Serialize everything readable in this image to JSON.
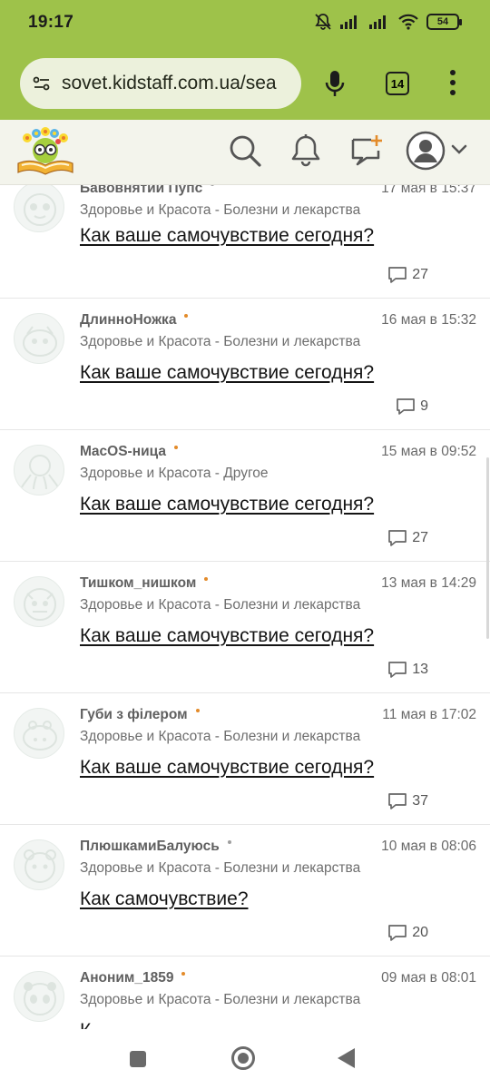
{
  "status_bar": {
    "time": "19:17",
    "battery": "54"
  },
  "browser": {
    "url": "sovet.kidstaff.com.ua/sea",
    "tabs_count": "14"
  },
  "site_header": {
    "icons": [
      "search-icon",
      "bell-icon",
      "new-post-icon",
      "avatar",
      "chevron-down-icon"
    ]
  },
  "feed": [
    {
      "author": "Бавовнятий Пупс",
      "date": "17 мая в 15:37",
      "category": "Здоровье и Красота - Болезни и лекарства",
      "title": "Как ваше самочувствие сегодня?",
      "comments": "27",
      "dot_color": "#9e9e9e"
    },
    {
      "author": "ДлинноНожка",
      "date": "16 мая в 15:32",
      "category": "Здоровье и Красота - Болезни и лекарства",
      "title": "Как ваше самочувствие сегодня?",
      "comments": "9",
      "dot_color": "#e38b2a"
    },
    {
      "author": "MacOS-ница",
      "date": "15 мая в 09:52",
      "category": "Здоровье и Красота - Другое",
      "title": "Как ваше самочувствие сегодня?",
      "comments": "27",
      "dot_color": "#e38b2a"
    },
    {
      "author": "Тишком_нишком",
      "date": "13 мая в 14:29",
      "category": "Здоровье и Красота - Болезни и лекарства",
      "title": "Как ваше самочувствие сегодня?",
      "comments": "13",
      "dot_color": "#e38b2a"
    },
    {
      "author": "Губи з філером",
      "date": "11 мая в 17:02",
      "category": "Здоровье и Красота - Болезни и лекарства",
      "title": "Как ваше самочувствие сегодня?",
      "comments": "37",
      "dot_color": "#e38b2a"
    },
    {
      "author": "ПлюшкамиБалуюсь",
      "date": "10 мая в 08:06",
      "category": "Здоровье и Красота - Болезни и лекарства",
      "title": "Как самочувствие?",
      "comments": "20",
      "dot_color": "#9e9e9e"
    },
    {
      "author": "Аноним_1859",
      "date": "09 мая в 08:01",
      "category": "Здоровье и Красота - Болезни и лекарства",
      "title": "К",
      "comments": "",
      "dot_color": "#e38b2a"
    }
  ],
  "colors": {
    "browser_bar": "#9ec24a",
    "site_header": "#f3f4ec",
    "accent_dot": "#e38b2a"
  }
}
